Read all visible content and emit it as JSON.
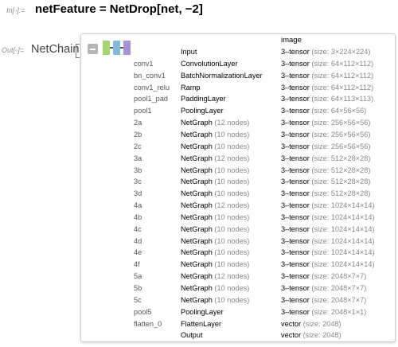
{
  "cells": {
    "input_label": "In[◦]:=",
    "input_expr": "netFeature = NetDrop[net, −2]",
    "output_label": "Out[◦]=",
    "output_head": "NetChain"
  },
  "icon_colors": {
    "block1": "#a7d66b",
    "block2": "#7dbfd9",
    "block3": "#a98fd6",
    "collapse": "#b5b5b5"
  },
  "panel": {
    "column_header": "image",
    "rows": [
      {
        "name": "",
        "type": "Input",
        "nodes": "",
        "tensor": "3–tensor",
        "size": "(size: 3×224×224)"
      },
      {
        "name": "conv1",
        "type": "ConvolutionLayer",
        "nodes": "",
        "tensor": "3–tensor",
        "size": "(size: 64×112×112)"
      },
      {
        "name": "bn_conv1",
        "type": "BatchNormalizationLayer",
        "nodes": "",
        "tensor": "3–tensor",
        "size": "(size: 64×112×112)"
      },
      {
        "name": "conv1_relu",
        "type": "Ramp",
        "nodes": "",
        "tensor": "3–tensor",
        "size": "(size: 64×112×112)"
      },
      {
        "name": "pool1_pad",
        "type": "PaddingLayer",
        "nodes": "",
        "tensor": "3–tensor",
        "size": "(size: 64×113×113)"
      },
      {
        "name": "pool1",
        "type": "PoolingLayer",
        "nodes": "",
        "tensor": "3–tensor",
        "size": "(size: 64×56×56)"
      },
      {
        "name": "2a",
        "type": "NetGraph",
        "nodes": "(12 nodes)",
        "tensor": "3–tensor",
        "size": "(size: 256×56×56)"
      },
      {
        "name": "2b",
        "type": "NetGraph",
        "nodes": "(10 nodes)",
        "tensor": "3–tensor",
        "size": "(size: 256×56×56)"
      },
      {
        "name": "2c",
        "type": "NetGraph",
        "nodes": "(10 nodes)",
        "tensor": "3–tensor",
        "size": "(size: 256×56×56)"
      },
      {
        "name": "3a",
        "type": "NetGraph",
        "nodes": "(12 nodes)",
        "tensor": "3–tensor",
        "size": "(size: 512×28×28)"
      },
      {
        "name": "3b",
        "type": "NetGraph",
        "nodes": "(10 nodes)",
        "tensor": "3–tensor",
        "size": "(size: 512×28×28)"
      },
      {
        "name": "3c",
        "type": "NetGraph",
        "nodes": "(10 nodes)",
        "tensor": "3–tensor",
        "size": "(size: 512×28×28)"
      },
      {
        "name": "3d",
        "type": "NetGraph",
        "nodes": "(10 nodes)",
        "tensor": "3–tensor",
        "size": "(size: 512×28×28)"
      },
      {
        "name": "4a",
        "type": "NetGraph",
        "nodes": "(12 nodes)",
        "tensor": "3–tensor",
        "size": "(size: 1024×14×14)"
      },
      {
        "name": "4b",
        "type": "NetGraph",
        "nodes": "(10 nodes)",
        "tensor": "3–tensor",
        "size": "(size: 1024×14×14)"
      },
      {
        "name": "4c",
        "type": "NetGraph",
        "nodes": "(10 nodes)",
        "tensor": "3–tensor",
        "size": "(size: 1024×14×14)"
      },
      {
        "name": "4d",
        "type": "NetGraph",
        "nodes": "(10 nodes)",
        "tensor": "3–tensor",
        "size": "(size: 1024×14×14)"
      },
      {
        "name": "4e",
        "type": "NetGraph",
        "nodes": "(10 nodes)",
        "tensor": "3–tensor",
        "size": "(size: 1024×14×14)"
      },
      {
        "name": "4f",
        "type": "NetGraph",
        "nodes": "(10 nodes)",
        "tensor": "3–tensor",
        "size": "(size: 1024×14×14)"
      },
      {
        "name": "5a",
        "type": "NetGraph",
        "nodes": "(12 nodes)",
        "tensor": "3–tensor",
        "size": "(size: 2048×7×7)"
      },
      {
        "name": "5b",
        "type": "NetGraph",
        "nodes": "(10 nodes)",
        "tensor": "3–tensor",
        "size": "(size: 2048×7×7)"
      },
      {
        "name": "5c",
        "type": "NetGraph",
        "nodes": "(10 nodes)",
        "tensor": "3–tensor",
        "size": "(size: 2048×7×7)"
      },
      {
        "name": "pool5",
        "type": "PoolingLayer",
        "nodes": "",
        "tensor": "3–tensor",
        "size": "(size: 2048×1×1)"
      },
      {
        "name": "flatten_0",
        "type": "FlattenLayer",
        "nodes": "",
        "tensor": "vector",
        "size": "(size: 2048)"
      },
      {
        "name": "",
        "type": "Output",
        "nodes": "",
        "tensor": "vector",
        "size": "(size: 2048)"
      }
    ]
  }
}
